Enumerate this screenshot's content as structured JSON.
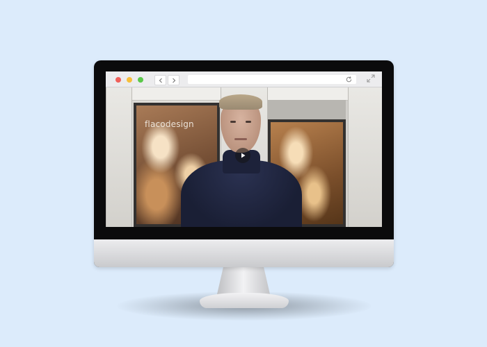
{
  "browser": {
    "traffic_lights": [
      "close",
      "minimize",
      "zoom"
    ],
    "colors": {
      "red": "#f0605a",
      "yellow": "#f7bf3a",
      "green": "#5ac84a"
    },
    "address_value": ""
  },
  "video": {
    "sign_text": "flacodesign",
    "state": "paused",
    "icons": [
      "back-icon",
      "forward-icon",
      "reload-icon",
      "expand-icon",
      "play-icon"
    ]
  },
  "background_color": "#dcebfb"
}
